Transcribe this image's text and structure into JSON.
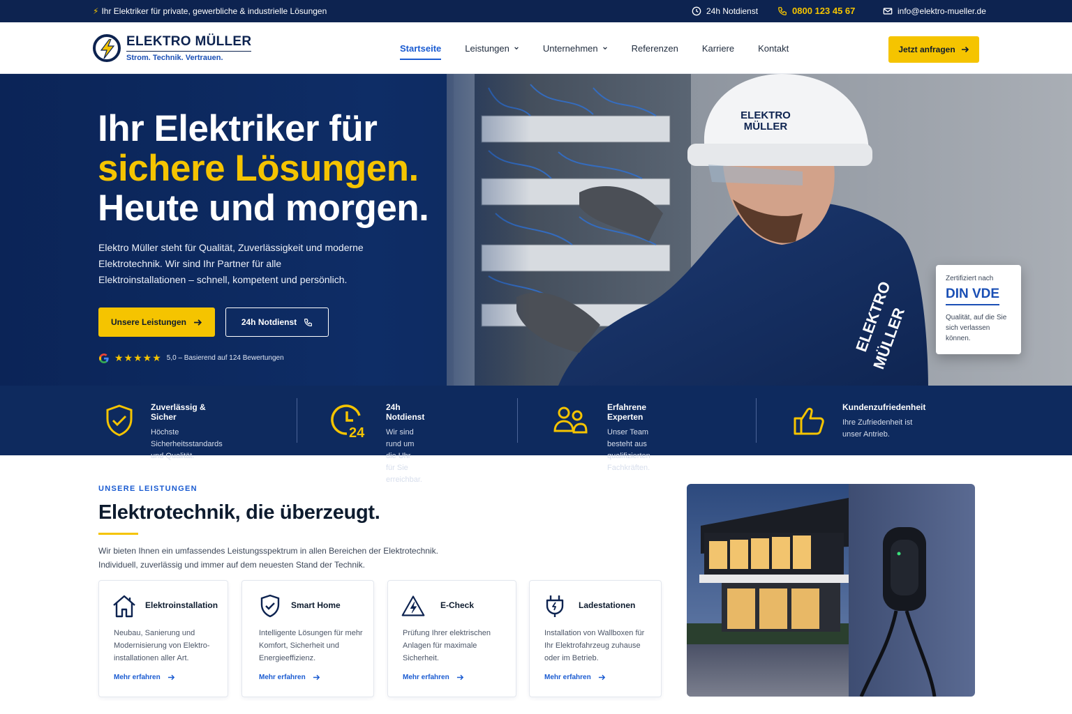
{
  "topbar": {
    "tagline": "Ihr Elektriker für private, gewerbliche & industrielle Lösungen",
    "notdienst": "24h Notdienst",
    "phone": "0800 123 45 67",
    "email": "info@elektro-mueller.de"
  },
  "header": {
    "brand_name": "ELEKTRO MÜLLER",
    "brand_claim": "Strom. Technik. Vertrauen.",
    "nav": [
      "Startseite",
      "Leistungen",
      "Unternehmen",
      "Referenzen",
      "Karriere",
      "Kontakt"
    ],
    "cta": "Jetzt anfragen"
  },
  "hero": {
    "line1": "Ihr Elektriker für",
    "line2": "sichere Lösungen.",
    "line3": "Heute und morgen.",
    "lead": "Elektro Müller steht für Qualität, Zuverlässigkeit und moderne Elektrotechnik. Wir sind Ihr Partner für alle Elektroinstallationen – schnell, kompetent und persönlich.",
    "btn_primary": "Unsere Leistungen",
    "btn_secondary": "24h Notdienst",
    "rating_text": "5,0 – Basierend auf 124 Bewertungen",
    "stars": 5,
    "helmet_text_1": "ELEKTRO",
    "helmet_text_2": "MÜLLER",
    "jacket_text_1": "ELEKTRO",
    "jacket_text_2": "MÜLLER"
  },
  "cert": {
    "label": "Zertifiziert nach",
    "title": "DIN VDE",
    "desc": "Qualität, auf die Sie sich verlassen können."
  },
  "features": [
    {
      "title": "Zuverlässig & Sicher",
      "desc": "Höchste Sicherheitsstandards\nund Qualität.",
      "icon": "shield-check-icon"
    },
    {
      "title": "24h Notdienst",
      "desc": "Wir sind rund um die Uhr\nfür Sie erreichbar.",
      "icon": "clock-24-icon",
      "badge": "24"
    },
    {
      "title": "Erfahrene Experten",
      "desc": "Unser Team besteht aus\nqualifizierten Fachkräften.",
      "icon": "team-icon"
    },
    {
      "title": "Kundenzufriedenheit",
      "desc": "Ihre Zufriedenheit ist\nunser Antrieb.",
      "icon": "thumbs-up-icon"
    }
  ],
  "services": {
    "eyebrow": "UNSERE LEISTUNGEN",
    "title": "Elektrotechnik, die überzeugt.",
    "intro": "Wir bieten Ihnen ein umfassendes Leistungsspektrum in allen Bereichen der Elektrotechnik. Individuell, zuverlässig und immer auf dem neuesten Stand der Technik.",
    "cards": [
      {
        "title": "Elektroinstallation",
        "desc": "Neubau, Sanierung und Modernisierung von Elektro-installationen aller Art.",
        "link": "Mehr erfahren",
        "icon": "house-icon"
      },
      {
        "title": "Smart Home",
        "desc": "Intelligente Lösungen für mehr Komfort, Sicherheit und Energieeffizienz.",
        "link": "Mehr erfahren",
        "icon": "shield-check-icon"
      },
      {
        "title": "E-Check",
        "desc": "Prüfung Ihrer elektrischen Anlagen für maximale Sicherheit.",
        "link": "Mehr erfahren",
        "icon": "warning-bolt-icon"
      },
      {
        "title": "Ladestationen",
        "desc": "Installation von Wallboxen für Ihr Elektrofahrzeug zuhause oder im Betrieb.",
        "link": "Mehr erfahren",
        "icon": "plug-icon"
      }
    ]
  },
  "colors": {
    "navy": "#0d2350",
    "yellow": "#f5c400",
    "blue": "#1a5bd1"
  }
}
